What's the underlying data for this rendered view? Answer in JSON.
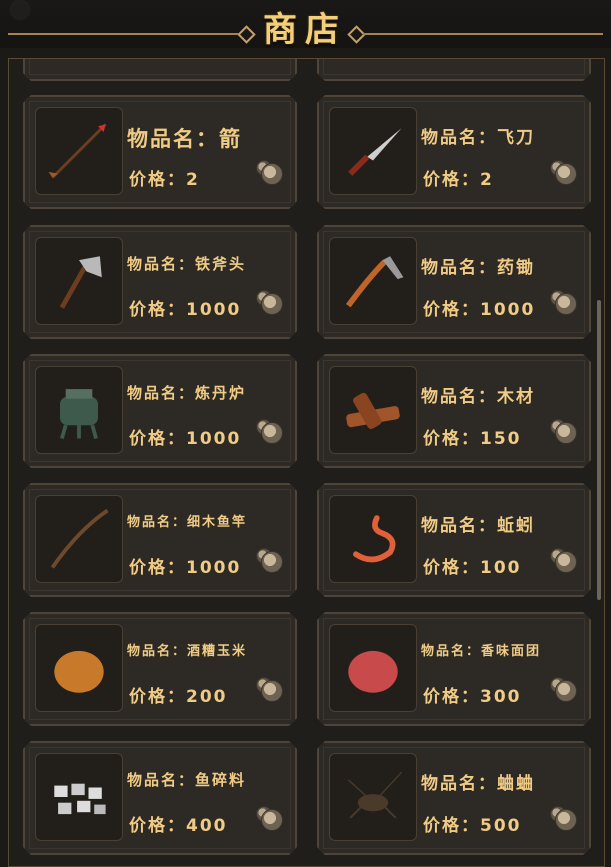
{
  "header": {
    "title": "商店"
  },
  "labels": {
    "name_prefix": "物品名：",
    "price_prefix": "价格："
  },
  "items": [
    {
      "name": "箭",
      "price": "2",
      "icon": "arrow-icon"
    },
    {
      "name": "飞刀",
      "price": "2",
      "icon": "flying-knife-icon"
    },
    {
      "name": "铁斧头",
      "price": "1000",
      "icon": "iron-axe-icon"
    },
    {
      "name": "药锄",
      "price": "1000",
      "icon": "herb-hoe-icon"
    },
    {
      "name": "炼丹炉",
      "price": "1000",
      "icon": "alchemy-furnace-icon"
    },
    {
      "name": "木材",
      "price": "150",
      "icon": "wood-icon"
    },
    {
      "name": "细木鱼竿",
      "price": "1000",
      "icon": "fishing-rod-icon"
    },
    {
      "name": "蚯蚓",
      "price": "100",
      "icon": "earthworm-icon"
    },
    {
      "name": "酒糟玉米",
      "price": "200",
      "icon": "corn-bait-icon"
    },
    {
      "name": "香味面团",
      "price": "300",
      "icon": "dough-bait-icon"
    },
    {
      "name": "鱼碎料",
      "price": "400",
      "icon": "fish-scraps-icon"
    },
    {
      "name": "蛐蛐",
      "price": "500",
      "icon": "cricket-icon"
    }
  ]
}
